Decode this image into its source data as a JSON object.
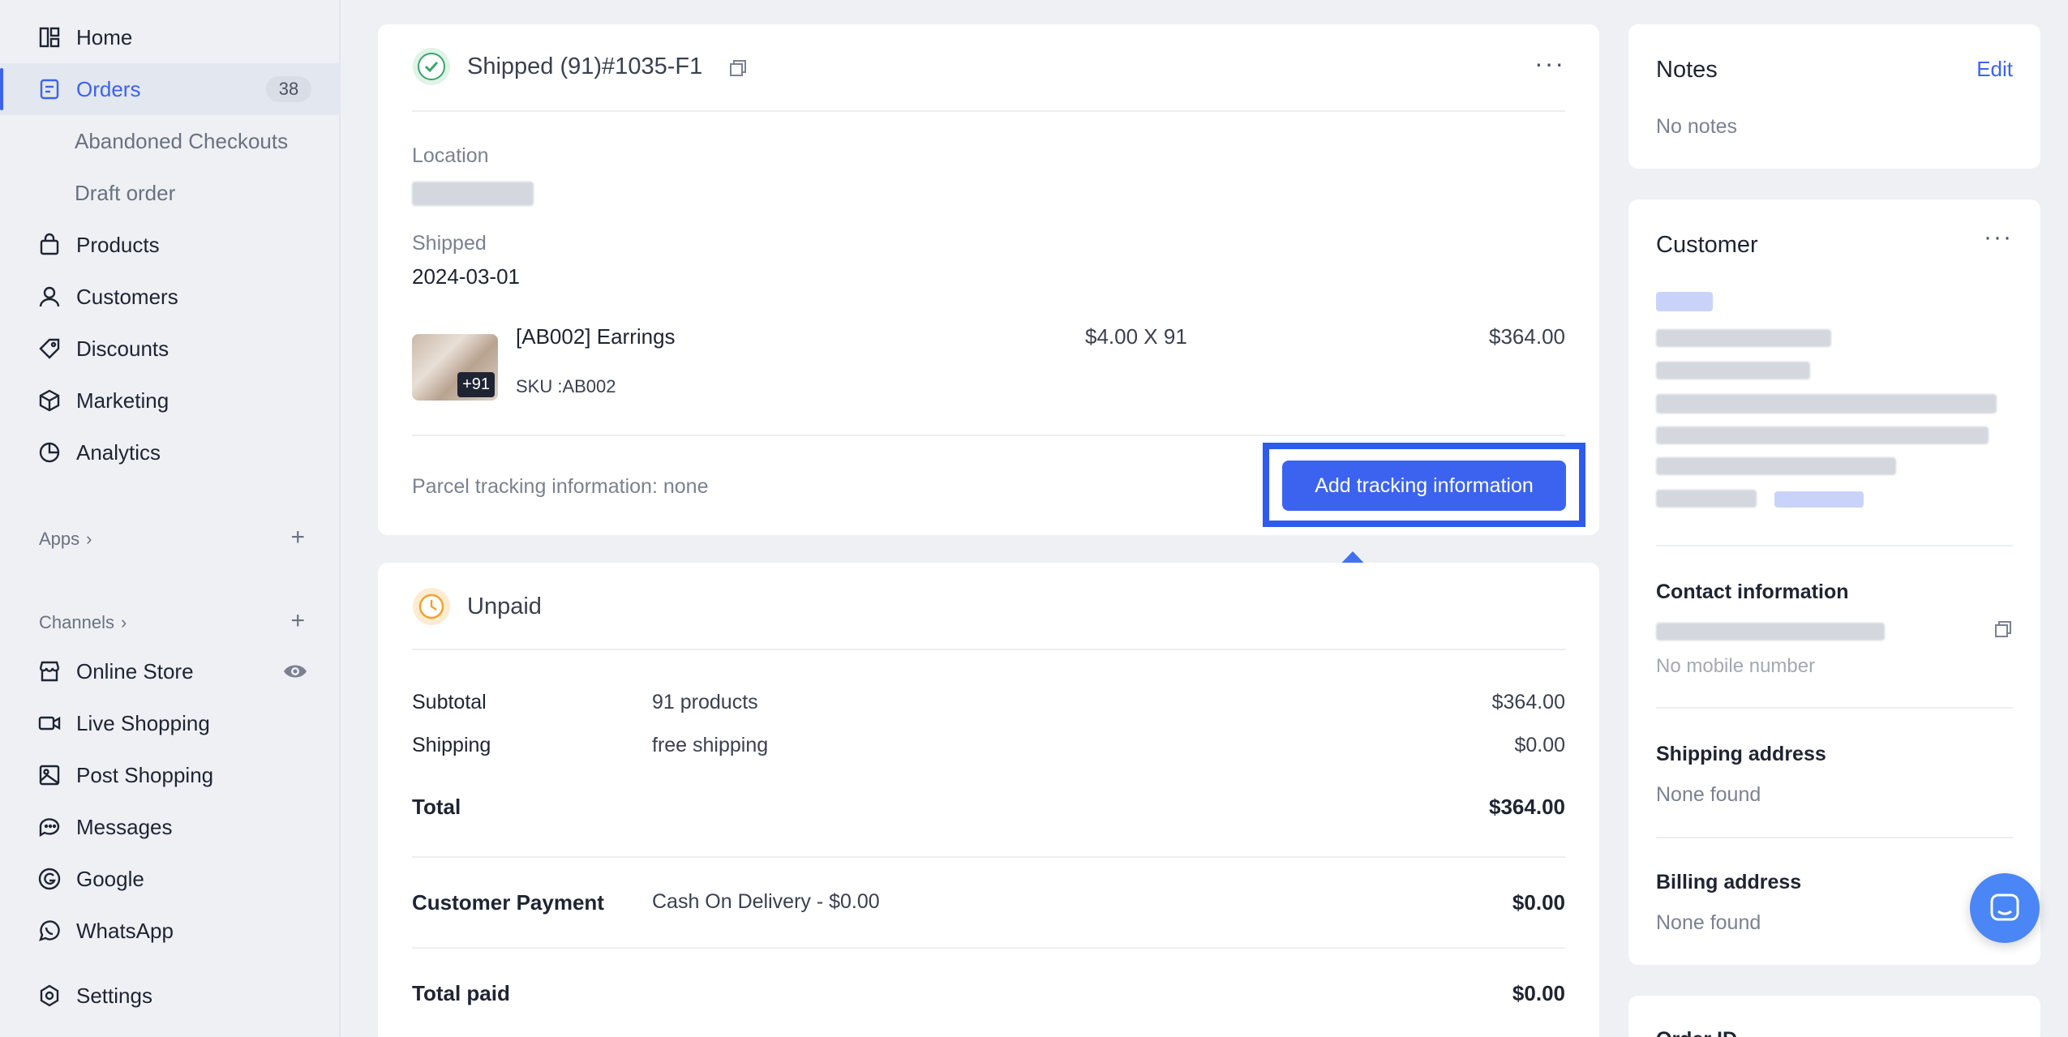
{
  "sidebar": {
    "items": [
      {
        "label": "Home",
        "icon": "home-icon"
      },
      {
        "label": "Orders",
        "icon": "orders-icon",
        "badge": "38"
      },
      {
        "label": "Abandoned Checkouts"
      },
      {
        "label": "Draft order"
      },
      {
        "label": "Products",
        "icon": "bag-icon"
      },
      {
        "label": "Customers",
        "icon": "person-icon"
      },
      {
        "label": "Discounts",
        "icon": "tag-icon"
      },
      {
        "label": "Marketing",
        "icon": "cube-icon"
      },
      {
        "label": "Analytics",
        "icon": "pie-chart-icon"
      }
    ],
    "apps_label": "Apps",
    "channels_label": "Channels",
    "channels": [
      {
        "label": "Online Store",
        "icon": "store-icon"
      },
      {
        "label": "Live Shopping",
        "icon": "video-icon"
      },
      {
        "label": "Post Shopping",
        "icon": "image-icon"
      },
      {
        "label": "Messages",
        "icon": "chat-icon"
      },
      {
        "label": "Google",
        "icon": "google-icon"
      },
      {
        "label": "WhatsApp",
        "icon": "whatsapp-icon"
      }
    ],
    "settings_label": "Settings"
  },
  "fulfillment": {
    "title": "Shipped (91)#1035-F1",
    "location_label": "Location",
    "shipped_label": "Shipped",
    "shipped_date": "2024-03-01",
    "item": {
      "name": "[AB002] Earrings",
      "sku": "SKU :AB002",
      "qty_badge": "+91",
      "price_qty": "$4.00 X 91",
      "total": "$364.00"
    },
    "tracking_text": "Parcel tracking information: none",
    "add_tracking_label": "Add tracking information"
  },
  "payment": {
    "title": "Unpaid",
    "rows": [
      {
        "label": "Subtotal",
        "desc": "91 products",
        "amount": "$364.00"
      },
      {
        "label": "Shipping",
        "desc": "free shipping",
        "amount": "$0.00"
      }
    ],
    "total_label": "Total",
    "total_amount": "$364.00",
    "customer_payment_label": "Customer Payment",
    "customer_payment_desc": "Cash On Delivery - $0.00",
    "customer_payment_amount": "$0.00",
    "total_paid_label": "Total paid",
    "total_paid_amount": "$0.00"
  },
  "notes": {
    "title": "Notes",
    "edit_label": "Edit",
    "body": "No notes"
  },
  "customer": {
    "title": "Customer",
    "contact_title": "Contact information",
    "no_mobile": "No mobile number",
    "shipping_title": "Shipping address",
    "shipping_value": "None found",
    "billing_title": "Billing address",
    "billing_value": "None found",
    "order_id_title": "Order ID"
  },
  "colors": {
    "accent": "#3b63f0",
    "highlight": "#2d5bf0",
    "success": "#3aa56a",
    "warning": "#f0a232"
  }
}
